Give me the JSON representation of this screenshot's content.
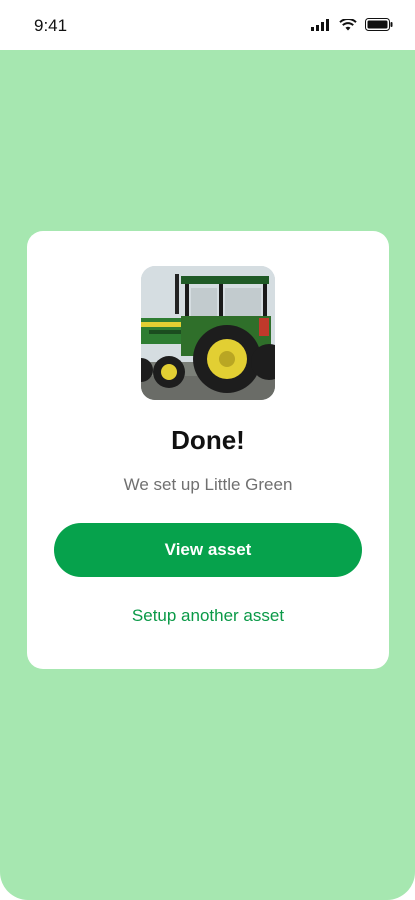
{
  "status_bar": {
    "time": "9:41",
    "icons": [
      "signal-icon",
      "wifi-icon",
      "battery-icon"
    ]
  },
  "screen": {
    "background": "#a6e7b0"
  },
  "card": {
    "image": {
      "alt": "tractor-image"
    },
    "title": "Done!",
    "subtitle": "We set up Little Green",
    "primary_button": {
      "label": "View asset",
      "color": "#06a24c"
    },
    "secondary_link": {
      "label": "Setup another asset",
      "color": "#0a9947"
    }
  }
}
